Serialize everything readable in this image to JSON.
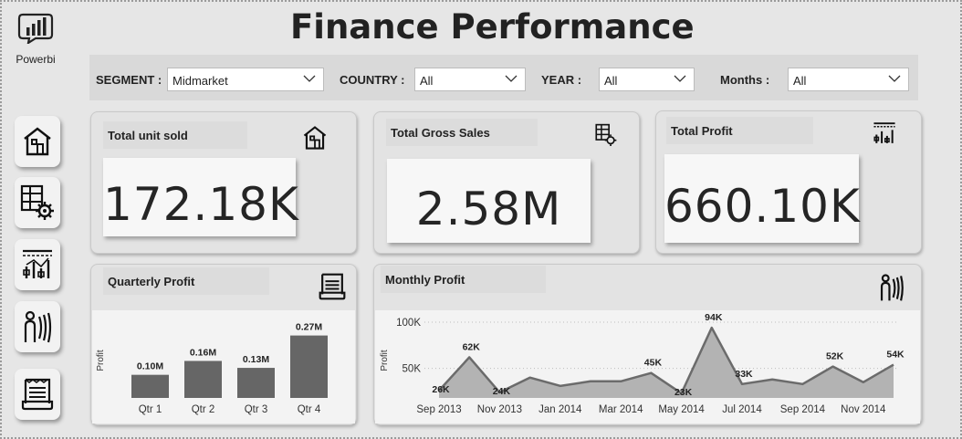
{
  "app": {
    "name": "Powerbi",
    "title": "Finance Performance"
  },
  "filters": [
    {
      "label": "SEGMENT :",
      "value": "Midmarket"
    },
    {
      "label": "COUNTRY :",
      "value": "All"
    },
    {
      "label": "YEAR :",
      "value": "All"
    },
    {
      "label": "Months :",
      "value": "All"
    }
  ],
  "nav": [
    {
      "icon": "home-icon"
    },
    {
      "icon": "grid-gear-icon"
    },
    {
      "icon": "chart-icon"
    },
    {
      "icon": "people-icon"
    },
    {
      "icon": "scroll-icon"
    }
  ],
  "kpis": [
    {
      "title": "Total unit sold",
      "value": "172.18K",
      "icon": "home-icon"
    },
    {
      "title": "Total Gross Sales",
      "value": "2.58M",
      "icon": "grid-gear-icon"
    },
    {
      "title": "Total Profit",
      "value": "660.10K",
      "icon": "chart-icon"
    }
  ],
  "quarterly": {
    "title": "Quarterly Profit",
    "icon": "scroll-icon",
    "chart_data": {
      "type": "bar",
      "categories": [
        "Qtr 1",
        "Qtr 2",
        "Qtr 3",
        "Qtr 4"
      ],
      "values": [
        0.1,
        0.16,
        0.13,
        0.27
      ],
      "data_labels": [
        "0.10M",
        "0.16M",
        "0.13M",
        "0.27M"
      ],
      "ylabel": "Profit",
      "ylim": [
        0,
        0.3
      ],
      "color": "#666666"
    }
  },
  "monthly": {
    "title": "Monthly Profit",
    "icon": "people-icon",
    "chart_data": {
      "type": "area",
      "x": [
        "2013-09",
        "2013-10",
        "2013-11",
        "2013-12",
        "2014-01",
        "2014-02",
        "2014-03",
        "2014-04",
        "2014-05",
        "2014-06",
        "2014-07",
        "2014-08",
        "2014-09",
        "2014-10",
        "2014-11",
        "2014-12"
      ],
      "values": [
        26,
        62,
        24,
        40,
        31,
        36,
        36,
        45,
        23,
        94,
        33,
        38,
        33,
        52,
        35,
        54
      ],
      "data_labels": {
        "0": "26K",
        "1": "62K",
        "2": "24K",
        "7": "45K",
        "8": "23K",
        "9": "94K",
        "10": "33K",
        "13": "52K",
        "15": "54K"
      },
      "x_tick_labels": [
        "Sep 2013",
        "Nov 2013",
        "Jan 2014",
        "Mar 2014",
        "May 2014",
        "Jul 2014",
        "Sep 2014",
        "Nov 2014"
      ],
      "y_tick_labels": [
        "100K",
        "50K"
      ],
      "y_ticks": [
        100,
        50
      ],
      "ylabel": "Profit",
      "ylim": [
        18,
        100
      ],
      "grid": true,
      "line_color": "#6b6b6b",
      "fill_color": "#b3b3b3"
    }
  }
}
